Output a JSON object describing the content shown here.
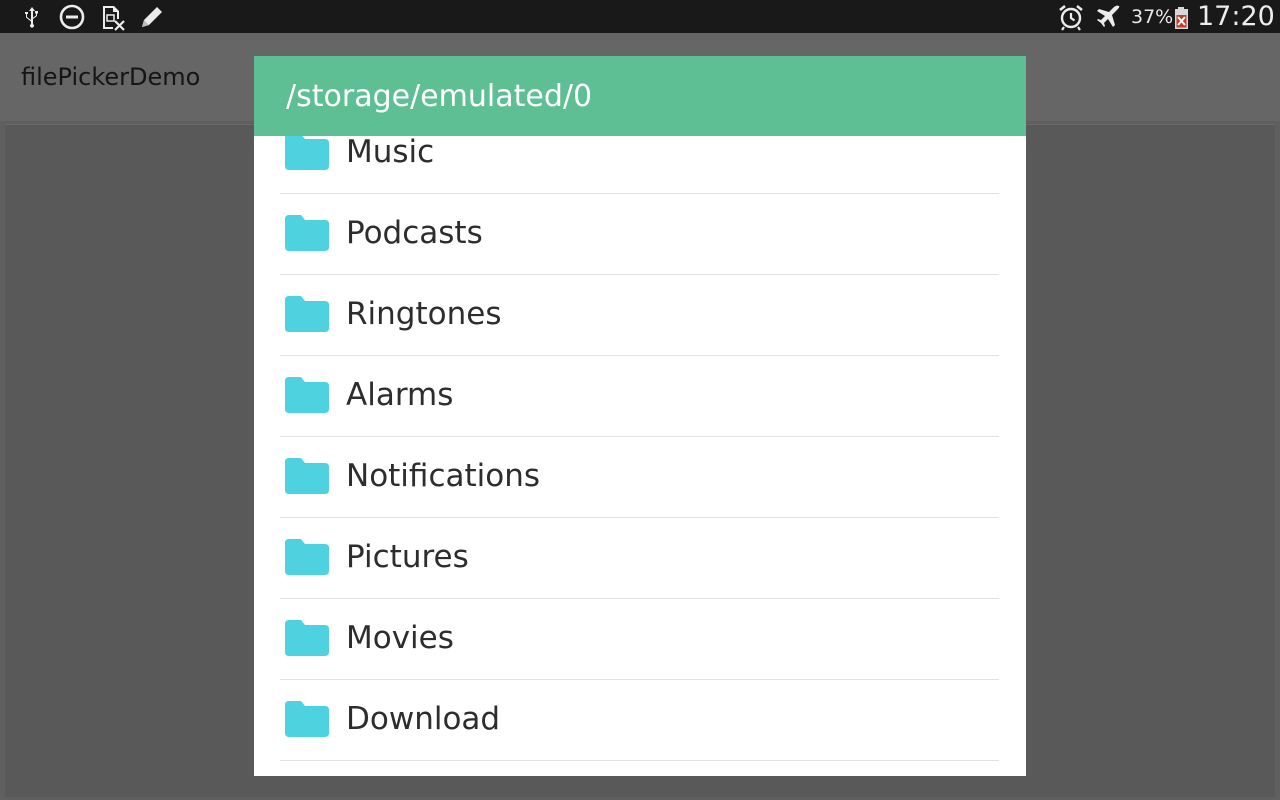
{
  "status_bar": {
    "battery_percent": "37%",
    "time": "17:20",
    "icons": [
      "usb-icon",
      "do-not-disturb-icon",
      "sim-missing-icon",
      "pen-icon",
      "alarm-icon",
      "airplane-mode-icon",
      "battery-icon"
    ]
  },
  "app": {
    "title": "filePickerDemo"
  },
  "dialog": {
    "title": "/storage/emulated/0",
    "header_color": "#5ebf94",
    "folder_color": "#4fd2e0",
    "items": [
      {
        "name": "Music",
        "icon": "folder-icon"
      },
      {
        "name": "Podcasts",
        "icon": "folder-icon"
      },
      {
        "name": "Ringtones",
        "icon": "folder-icon"
      },
      {
        "name": "Alarms",
        "icon": "folder-icon"
      },
      {
        "name": "Notifications",
        "icon": "folder-icon"
      },
      {
        "name": "Pictures",
        "icon": "folder-icon"
      },
      {
        "name": "Movies",
        "icon": "folder-icon"
      },
      {
        "name": "Download",
        "icon": "folder-icon"
      }
    ]
  }
}
